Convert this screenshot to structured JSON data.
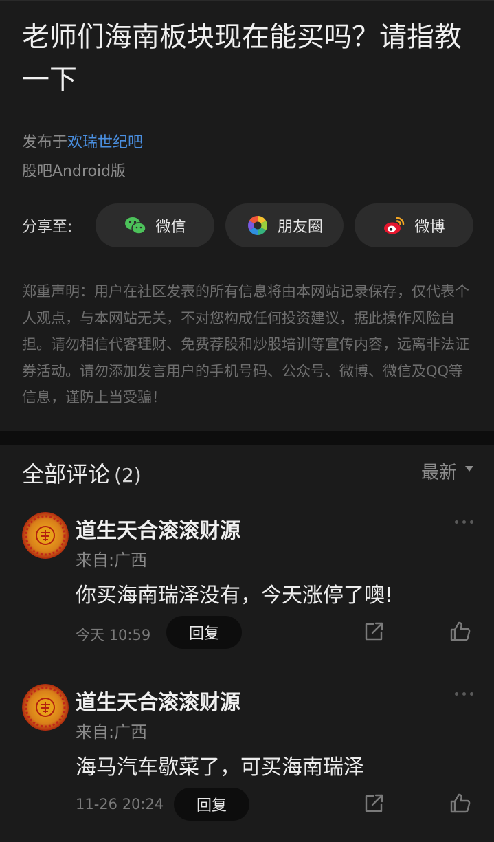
{
  "post": {
    "title": "老师们海南板块现在能买吗？请指教一下",
    "published_prefix": "发布于",
    "forum": "欢瑞世纪吧",
    "client": "股吧Android版",
    "share_label": "分享至:",
    "share": {
      "wechat": "微信",
      "moments": "朋友圈",
      "weibo": "微博"
    },
    "disclaimer": "郑重声明：用户在社区发表的所有信息将由本网站记录保存，仅代表个人观点，与本网站无关，不对您构成任何投资建议，据此操作风险自担。请勿相信代客理财、免费荐股和炒股培训等宣传内容，远离非法证券活动。请勿添加发言用户的手机号码、公众号、微博、微信及QQ等信息，谨防上当受骗！"
  },
  "comments_section": {
    "title": "全部评论",
    "count": "(2)",
    "sort": "最新",
    "items": [
      {
        "user": "道生天合滚滚财源",
        "location": "来自:广西",
        "text": "你买海南瑞泽没有，今天涨停了噢!",
        "time": "今天 10:59",
        "reply": "回复"
      },
      {
        "user": "道生天合滚滚财源",
        "location": "来自:广西",
        "text": "海马汽车歇菜了，可买海南瑞泽",
        "time": "11-26 20:24",
        "reply": "回复"
      }
    ]
  }
}
